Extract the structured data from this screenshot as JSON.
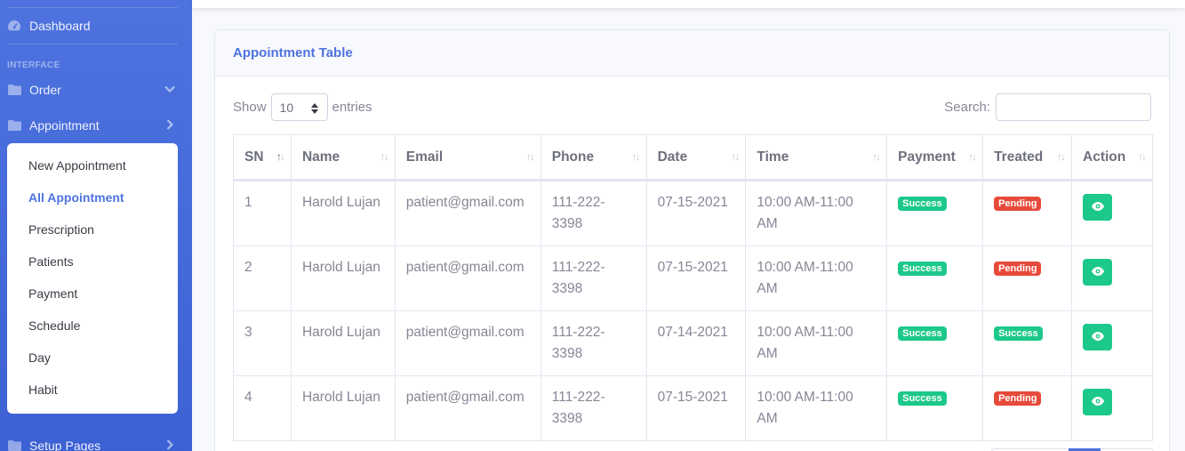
{
  "sidebar": {
    "dashboard_label": "Dashboard",
    "heading_interface": "INTERFACE",
    "order_label": "Order",
    "appointment_label": "Appointment",
    "setup_label": "Setup Pages",
    "submenu": [
      {
        "label": "New Appointment"
      },
      {
        "label": "All Appointment"
      },
      {
        "label": "Prescription"
      },
      {
        "label": "Patients"
      },
      {
        "label": "Payment"
      },
      {
        "label": "Schedule"
      },
      {
        "label": "Day"
      },
      {
        "label": "Habit"
      }
    ],
    "active_item": "All Appointment"
  },
  "card": {
    "title": "Appointment Table",
    "show_label": "Show",
    "entries_value": "10",
    "entries_label": "entries",
    "search_label": "Search:",
    "search_value": ""
  },
  "table": {
    "columns": [
      "SN",
      "Name",
      "Email",
      "Phone",
      "Date",
      "Time",
      "Payment",
      "Treated",
      "Action"
    ],
    "rows": [
      {
        "sn": "1",
        "name": "Harold Lujan",
        "email": "patient@gmail.com",
        "phone": "111-222-3398",
        "date": "07-15-2021",
        "time": "10:00 AM-11:00 AM",
        "payment": "Success",
        "treated": "Pending"
      },
      {
        "sn": "2",
        "name": "Harold Lujan",
        "email": "patient@gmail.com",
        "phone": "111-222-3398",
        "date": "07-15-2021",
        "time": "10:00 AM-11:00 AM",
        "payment": "Success",
        "treated": "Pending"
      },
      {
        "sn": "3",
        "name": "Harold Lujan",
        "email": "patient@gmail.com",
        "phone": "111-222-3398",
        "date": "07-14-2021",
        "time": "10:00 AM-11:00 AM",
        "payment": "Success",
        "treated": "Success"
      },
      {
        "sn": "4",
        "name": "Harold Lujan",
        "email": "patient@gmail.com",
        "phone": "111-222-3398",
        "date": "07-15-2021",
        "time": "10:00 AM-11:00 AM",
        "payment": "Success",
        "treated": "Pending"
      }
    ]
  },
  "colors": {
    "primary": "#4e73df",
    "success": "#1cc88a",
    "danger": "#e74a3b"
  }
}
